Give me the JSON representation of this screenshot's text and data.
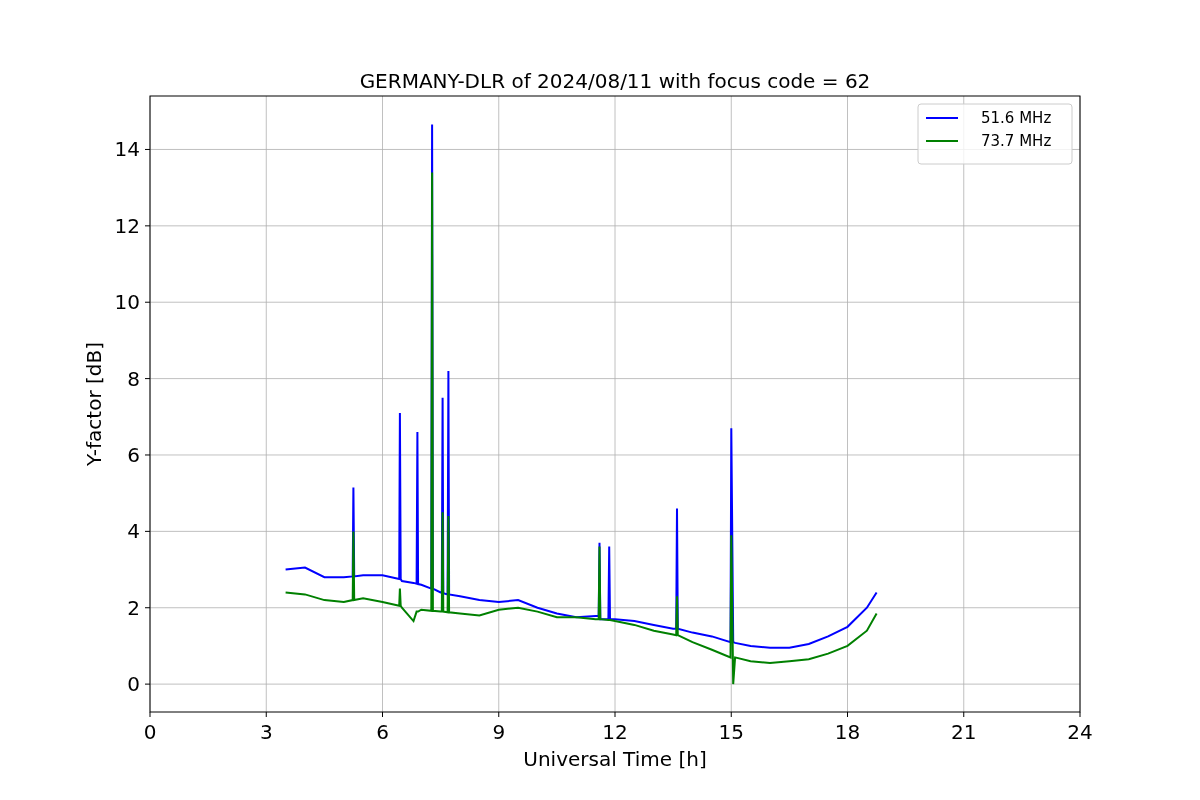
{
  "chart_data": {
    "type": "line",
    "title": "GERMANY-DLR of 2024/08/11 with focus code = 62",
    "xlabel": "Universal Time [h]",
    "ylabel": "Y-factor [dB]",
    "grid": true,
    "legend": true,
    "xlim": [
      0,
      24
    ],
    "ylim": [
      -0.73,
      15.4
    ],
    "xticks": [
      0,
      3,
      6,
      9,
      12,
      15,
      18,
      21,
      24
    ],
    "yticks": [
      0,
      2,
      4,
      6,
      8,
      10,
      12,
      14
    ],
    "x": [
      3.5,
      4,
      4.5,
      5,
      5.23,
      5.25,
      5.27,
      5.5,
      6,
      6.43,
      6.45,
      6.47,
      6.5,
      6.8,
      6.88,
      6.9,
      6.92,
      7,
      7.26,
      7.28,
      7.3,
      7.5,
      7.53,
      7.55,
      7.57,
      7.68,
      7.7,
      7.72,
      8,
      8.5,
      9,
      9.5,
      10,
      10.5,
      11,
      11.5,
      11.58,
      11.6,
      11.62,
      11.83,
      11.85,
      11.87,
      12,
      12.5,
      13,
      13.5,
      13.58,
      13.6,
      13.62,
      14,
      14.5,
      14.98,
      15,
      15.05,
      15.1,
      15.5,
      16,
      16.5,
      17,
      17.5,
      18,
      18.5,
      18.75
    ],
    "series": [
      {
        "name": "51.6 MHz",
        "color": "#0000ff",
        "values": [
          3.0,
          3.05,
          2.8,
          2.8,
          2.82,
          5.15,
          2.82,
          2.85,
          2.85,
          2.75,
          7.1,
          2.75,
          2.7,
          2.65,
          2.63,
          6.6,
          2.62,
          2.6,
          2.5,
          14.65,
          2.5,
          2.4,
          2.4,
          7.5,
          2.38,
          2.35,
          8.2,
          2.35,
          2.3,
          2.2,
          2.15,
          2.2,
          2.0,
          1.85,
          1.75,
          1.78,
          1.78,
          3.7,
          1.7,
          1.7,
          3.6,
          1.7,
          1.7,
          1.65,
          1.55,
          1.45,
          1.45,
          4.6,
          1.45,
          1.35,
          1.25,
          1.1,
          6.7,
          1.1,
          1.08,
          1.0,
          0.95,
          0.95,
          1.05,
          1.25,
          1.5,
          2.0,
          2.4
        ]
      },
      {
        "name": "73.7 MHz",
        "color": "#008000",
        "values": [
          2.4,
          2.35,
          2.2,
          2.15,
          2.2,
          4.0,
          2.2,
          2.25,
          2.15,
          2.05,
          2.5,
          2.05,
          2.0,
          1.65,
          1.9,
          1.9,
          1.9,
          1.95,
          1.92,
          13.4,
          1.92,
          1.9,
          1.9,
          4.5,
          1.9,
          1.88,
          4.4,
          1.88,
          1.85,
          1.8,
          1.95,
          2.0,
          1.9,
          1.75,
          1.75,
          1.7,
          1.7,
          3.6,
          1.7,
          1.68,
          1.68,
          1.68,
          1.65,
          1.55,
          1.4,
          1.3,
          1.28,
          2.3,
          1.28,
          1.1,
          0.9,
          0.7,
          3.9,
          0.0,
          0.7,
          0.6,
          0.55,
          0.6,
          0.65,
          0.8,
          1.0,
          1.4,
          1.85
        ]
      }
    ]
  }
}
